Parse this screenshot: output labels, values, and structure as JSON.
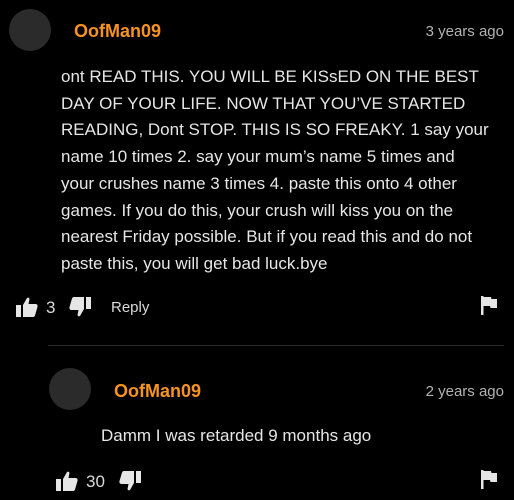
{
  "colors": {
    "accent": "#f7931e",
    "background": "#000000"
  },
  "comments": [
    {
      "author": "OofMan09",
      "time": "3 years ago",
      "text_lines": [
        "ont READ THIS. YOU WILL BE KISsED ON THE BEST",
        "DAY OF YOUR LIFE. NOW THAT YOU’VE STARTED",
        "READING, Dont STOP. THIS IS SO FREAKY. 1 say your",
        "name 10 times 2. say your mum’s name 5 times and",
        "your crushes name 3 times 4. paste this onto 4 other",
        "games. If you do this, your crush will kiss you on the",
        "nearest Friday possible. But if you read this and do not",
        "paste this, you will get bad luck.bye"
      ],
      "likes": "3",
      "reply_label": "Reply",
      "icons": [
        "thumbs-up-icon",
        "thumbs-down-icon",
        "flag-icon"
      ]
    },
    {
      "author": "OofMan09",
      "time": "2 years ago",
      "text": "Damm I was retarded 9 months ago",
      "likes": "30",
      "icons": [
        "thumbs-up-icon",
        "thumbs-down-icon",
        "flag-icon"
      ]
    }
  ]
}
